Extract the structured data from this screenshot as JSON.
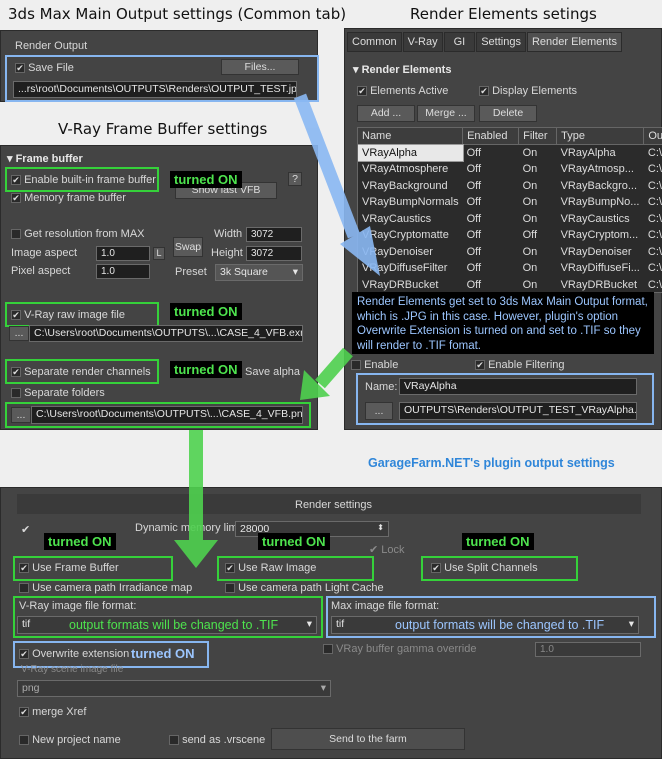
{
  "headings": {
    "common_tab": "3ds Max Main Output settings (Common tab)",
    "render_elements": "Render Elements setings",
    "vfb": "V-Ray Frame Buffer settings",
    "garagefarm": "GarageFarm.NET's plugin output settings"
  },
  "main_output": {
    "group_label": "Render Output",
    "save_file_label": "Save File",
    "files_button": "Files...",
    "path": "...rs\\root\\Documents\\OUTPUTS\\Renders\\OUTPUT_TEST.jpg"
  },
  "render_elements": {
    "tabs": [
      "Common",
      "V-Ray",
      "GI",
      "Settings",
      "Render Elements"
    ],
    "rollout_title": "Render Elements",
    "elements_active": "Elements Active",
    "display_elements": "Display Elements",
    "add_button": "Add ...",
    "merge_button": "Merge ...",
    "delete_button": "Delete",
    "columns": [
      "Name",
      "Enabled",
      "Filter",
      "Type",
      "Ou"
    ],
    "rows": [
      [
        "VRayAlpha",
        "Off",
        "On",
        "VRayAlpha",
        "C:\\"
      ],
      [
        "VRayAtmosphere",
        "Off",
        "On",
        "VRayAtmosp...",
        "C:\\"
      ],
      [
        "VRayBackground",
        "Off",
        "On",
        "VRayBackgro...",
        "C:\\"
      ],
      [
        "VRayBumpNormals",
        "Off",
        "On",
        "VRayBumpNo...",
        "C:\\"
      ],
      [
        "VRayCaustics",
        "Off",
        "On",
        "VRayCaustics",
        "C:\\"
      ],
      [
        "VRayCryptomatte",
        "Off",
        "Off",
        "VRayCryptom...",
        "C:\\"
      ],
      [
        "VRayDenoiser",
        "Off",
        "On",
        "VRayDenoiser",
        "C:\\"
      ],
      [
        "VRayDiffuseFilter",
        "Off",
        "On",
        "VRayDiffuseFi...",
        "C:\\"
      ],
      [
        "VRayDRBucket",
        "Off",
        "On",
        "VRayDRBucket",
        "C:\\"
      ]
    ],
    "enable_label": "Enable",
    "enable_filtering_label": "Enable Filtering",
    "name_label": "Name:",
    "name_value": "VRayAlpha",
    "browse_button": "...",
    "element_path": "OUTPUTS\\Renders\\OUTPUT_TEST_VRayAlpha.jpg",
    "note": "Render Elements get set to 3ds Max Main Output format, which is .JPG in this case. However, plugin's option Overwrite Extension is turned on and set to .TIF so they will render to .TIF fomat."
  },
  "vfb": {
    "rollout_title": "Frame buffer",
    "enable_builtin": "Enable built-in frame buffer",
    "memory_fb": "Memory frame buffer",
    "show_last_vfb": "Show last VFB",
    "help_button": "?",
    "get_resolution": "Get resolution from MAX",
    "image_aspect_label": "Image aspect",
    "image_aspect_value": "1.0",
    "pixel_aspect_label": "Pixel aspect",
    "pixel_aspect_value": "1.0",
    "lock_label": "L",
    "swap_button": "Swap",
    "width_label": "Width",
    "width_value": "3072",
    "height_label": "Height",
    "height_value": "3072",
    "preset_label": "Preset",
    "preset_value": "3k Square",
    "raw_image_label": "V-Ray raw image file",
    "raw_image_path": "C:\\Users\\root\\Documents\\OUTPUTS\\...\\CASE_4_VFB.exr",
    "separate_channels": "Separate render channels",
    "save_alpha": "Save alpha",
    "separate_folders": "Separate folders",
    "channels_path": "C:\\Users\\root\\Documents\\OUTPUTS\\...\\CASE_4_VFB.png",
    "browse_button": "..."
  },
  "plugin": {
    "title": "Render settings",
    "dynamic_memory_label": "Dynamic memory limit",
    "dynamic_memory_value": "28000",
    "lock_label": "Lock",
    "use_frame_buffer": "Use Frame Buffer",
    "use_raw_image": "Use Raw Image",
    "use_split_channels": "Use Split Channels",
    "irradiance_map": "Use camera path Irradiance map",
    "light_cache": "Use camera path Light Cache",
    "vray_format_label": "V-Ray image file format:",
    "vray_format_value": "tif",
    "max_format_label": "Max image file format:",
    "max_format_value": "tif",
    "output_note": "output formats will be changed to .TIF",
    "overwrite_extension": "Overwrite extension",
    "gamma_override": "VRay buffer gamma override",
    "gamma_value": "1.0",
    "vrscene_label": "V-Ray scene image file",
    "vrscene_value": "png",
    "merge_xref": "merge Xref",
    "new_project": "New project name",
    "send_vrscene": "send as .vrscene",
    "send_button": "Send to the farm"
  },
  "annotations": {
    "turned_on": "turned ON"
  },
  "colors": {
    "highlight_green": "#35d13a",
    "highlight_blue": "#87b6f0",
    "panel_bg": "#444444",
    "label_text_green": "#4ee34e"
  }
}
